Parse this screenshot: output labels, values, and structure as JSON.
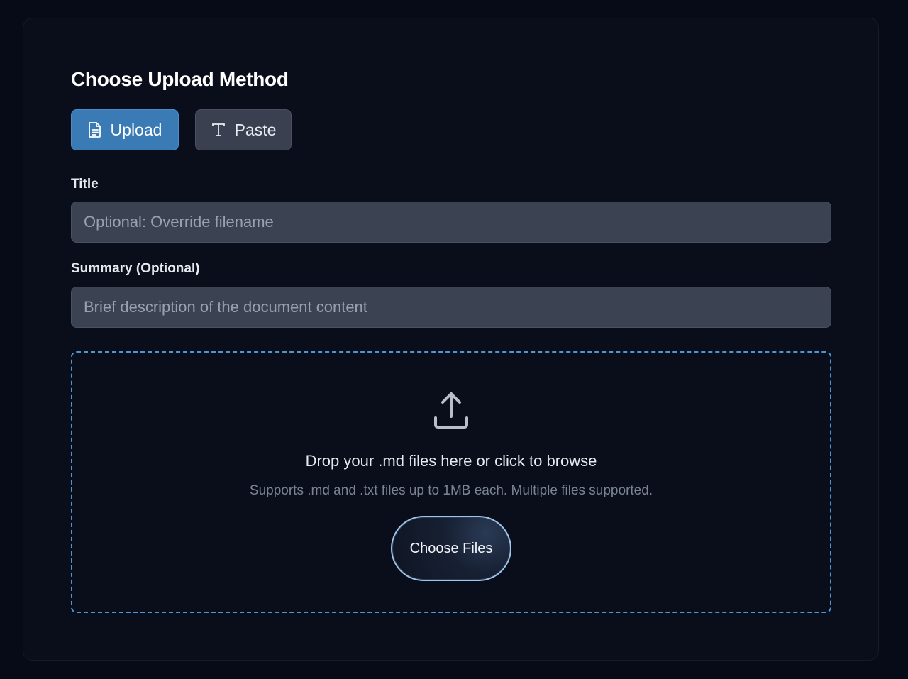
{
  "heading": "Choose Upload Method",
  "methods": {
    "upload_label": "Upload",
    "paste_label": "Paste",
    "upload_icon": "document-icon",
    "paste_icon": "text-icon",
    "active": "upload"
  },
  "title_field": {
    "label": "Title",
    "placeholder": "Optional: Override filename",
    "value": ""
  },
  "summary_field": {
    "label": "Summary (Optional)",
    "placeholder": "Brief description of the document content",
    "value": ""
  },
  "dropzone": {
    "icon": "upload-icon",
    "main_text": "Drop your .md files here or click to browse",
    "sub_text": "Supports .md and .txt files up to 1MB each. Multiple files supported.",
    "button_label": "Choose Files"
  },
  "colors": {
    "background": "#070b18",
    "card": "#0a0e1a",
    "accent": "#3a7ab5",
    "dropzone_border": "#4f94d4",
    "input_bg": "#3b4252"
  }
}
